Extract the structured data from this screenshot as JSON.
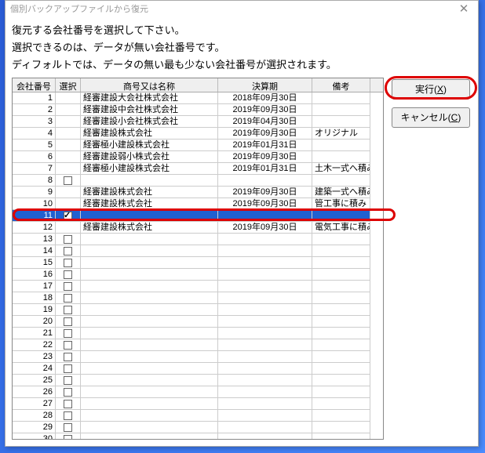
{
  "window": {
    "title": "個別バックアップファイルから復元"
  },
  "desc": {
    "line1": "復元する会社番号を選択して下さい。",
    "line2": "選択できるのは、データが無い会社番号です。",
    "line3": "ディフォルトでは、データの無い最も少ない会社番号が選択されます。"
  },
  "headers": {
    "id": "会社番号",
    "sel": "選択",
    "name": "商号又は名称",
    "period": "決算期",
    "remarks": "備考"
  },
  "buttons": {
    "exec": "実行(",
    "exec_u": "X",
    "exec_e": ")",
    "cancel": "キャンセル(",
    "cancel_u": "C",
    "cancel_e": ")"
  },
  "rows": [
    {
      "id": 1,
      "chk": null,
      "name": "経審建設大会社株式会社",
      "period": "2018年09月30日",
      "remarks": ""
    },
    {
      "id": 2,
      "chk": null,
      "name": "経審建設中会社株式会社",
      "period": "2019年09月30日",
      "remarks": ""
    },
    {
      "id": 3,
      "chk": null,
      "name": "経審建設小会社株式会社",
      "period": "2019年04月30日",
      "remarks": ""
    },
    {
      "id": 4,
      "chk": null,
      "name": "経審建設株式会社",
      "period": "2019年09月30日",
      "remarks": "オリジナル"
    },
    {
      "id": 5,
      "chk": null,
      "name": "経審極小建設株式会社",
      "period": "2019年01月31日",
      "remarks": ""
    },
    {
      "id": 6,
      "chk": null,
      "name": "経審建設弱小株式会社",
      "period": "2019年09月30日",
      "remarks": ""
    },
    {
      "id": 7,
      "chk": null,
      "name": "経審極小建設株式会社",
      "period": "2019年01月31日",
      "remarks": "土木一式へ積み"
    },
    {
      "id": 8,
      "chk": false,
      "name": "",
      "period": "",
      "remarks": ""
    },
    {
      "id": 9,
      "chk": null,
      "name": "経審建設株式会社",
      "period": "2019年09月30日",
      "remarks": "建築一式へ積み"
    },
    {
      "id": 10,
      "chk": null,
      "name": "経審建設株式会社",
      "period": "2019年09月30日",
      "remarks": "管工事に積み"
    },
    {
      "id": 11,
      "chk": true,
      "name": "",
      "period": "",
      "remarks": "",
      "selected": true
    },
    {
      "id": 12,
      "chk": null,
      "name": "経審建設株式会社",
      "period": "2019年09月30日",
      "remarks": "電気工事に積み"
    },
    {
      "id": 13,
      "chk": false,
      "name": "",
      "period": "",
      "remarks": ""
    },
    {
      "id": 14,
      "chk": false,
      "name": "",
      "period": "",
      "remarks": ""
    },
    {
      "id": 15,
      "chk": false,
      "name": "",
      "period": "",
      "remarks": ""
    },
    {
      "id": 16,
      "chk": false,
      "name": "",
      "period": "",
      "remarks": ""
    },
    {
      "id": 17,
      "chk": false,
      "name": "",
      "period": "",
      "remarks": ""
    },
    {
      "id": 18,
      "chk": false,
      "name": "",
      "period": "",
      "remarks": ""
    },
    {
      "id": 19,
      "chk": false,
      "name": "",
      "period": "",
      "remarks": ""
    },
    {
      "id": 20,
      "chk": false,
      "name": "",
      "period": "",
      "remarks": ""
    },
    {
      "id": 21,
      "chk": false,
      "name": "",
      "period": "",
      "remarks": ""
    },
    {
      "id": 22,
      "chk": false,
      "name": "",
      "period": "",
      "remarks": ""
    },
    {
      "id": 23,
      "chk": false,
      "name": "",
      "period": "",
      "remarks": ""
    },
    {
      "id": 24,
      "chk": false,
      "name": "",
      "period": "",
      "remarks": ""
    },
    {
      "id": 25,
      "chk": false,
      "name": "",
      "period": "",
      "remarks": ""
    },
    {
      "id": 26,
      "chk": false,
      "name": "",
      "period": "",
      "remarks": ""
    },
    {
      "id": 27,
      "chk": false,
      "name": "",
      "period": "",
      "remarks": ""
    },
    {
      "id": 28,
      "chk": false,
      "name": "",
      "period": "",
      "remarks": ""
    },
    {
      "id": 29,
      "chk": false,
      "name": "",
      "period": "",
      "remarks": ""
    },
    {
      "id": 30,
      "chk": false,
      "name": "",
      "period": "",
      "remarks": ""
    }
  ]
}
